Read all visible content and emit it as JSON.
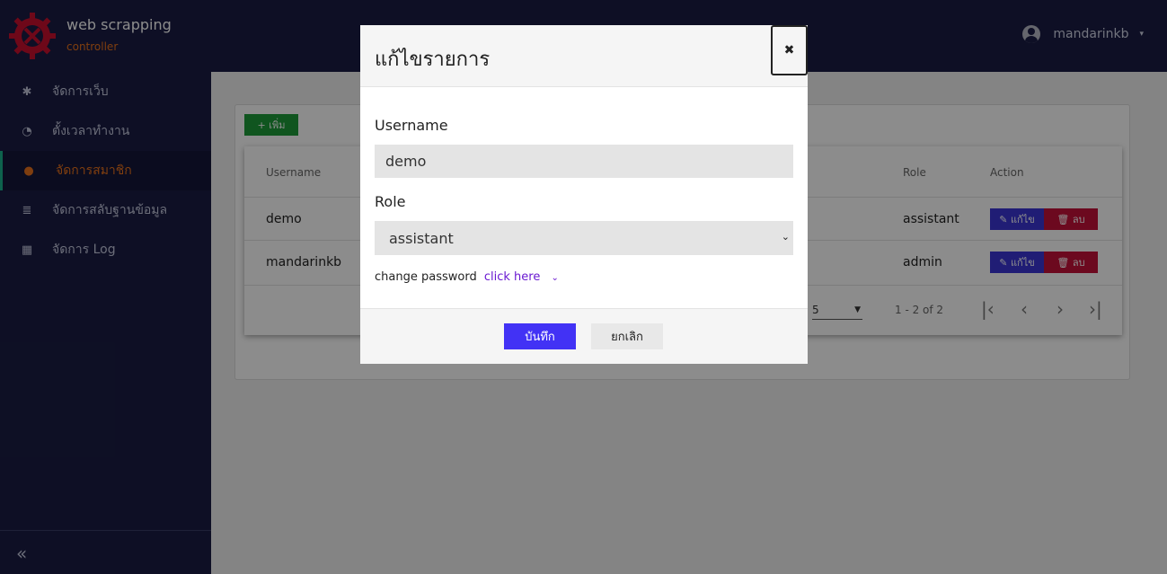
{
  "app": {
    "title": "web scrapping",
    "subtitle": "controller",
    "user_name": "mandarinkb",
    "user_caret": "▾"
  },
  "sidebar": {
    "items": [
      {
        "icon": "gear-icon",
        "glyph": "✱",
        "label": "จัดการเว็บ"
      },
      {
        "icon": "clock-icon",
        "glyph": "◔",
        "label": "ตั้งเวลาทำงาน"
      },
      {
        "icon": "users-icon",
        "glyph": "●",
        "label": "จัดการสมาชิก",
        "active": true
      },
      {
        "icon": "database-icon",
        "glyph": "≣",
        "label": "จัดการสลับฐานข้อมูล"
      },
      {
        "icon": "calendar-icon",
        "glyph": "▦",
        "label": "จัดการ Log"
      }
    ],
    "collapse_icon": "«"
  },
  "main": {
    "add_button": "+ เพิ่ม",
    "table": {
      "headers": {
        "username": "Username",
        "role": "Role",
        "action": "Action"
      },
      "rows": [
        {
          "username": "demo",
          "role": "assistant",
          "edit": "✎ แก้ไข",
          "delete": "🗑 ลบ"
        },
        {
          "username": "mandarinkb",
          "role": "admin",
          "edit": "✎ แก้ไข",
          "delete": "🗑 ลบ"
        }
      ]
    },
    "pagination": {
      "per_page": "5",
      "per_page_caret": "▼",
      "info": "1 - 2 of 2",
      "first": "|‹",
      "prev": "‹",
      "next": "›",
      "last": "›|"
    }
  },
  "modal": {
    "title": "แก้ไขรายการ",
    "close": "✖",
    "username_label": "Username",
    "username_value": "demo",
    "role_label": "Role",
    "role_value": "assistant",
    "role_caret": "⌄",
    "change_password_text": "change password",
    "change_password_link": "click here",
    "change_password_chevron": "⌄",
    "save_label": "บันทึก",
    "cancel_label": "ยกเลิก"
  },
  "colors": {
    "navy": "#1a1d44",
    "accent_orange": "#e8721c",
    "active_bar": "#1ab38a",
    "primary": "#4232f5",
    "edit": "#3b36d6",
    "delete": "#c5123a",
    "add": "#1e9b3a"
  }
}
